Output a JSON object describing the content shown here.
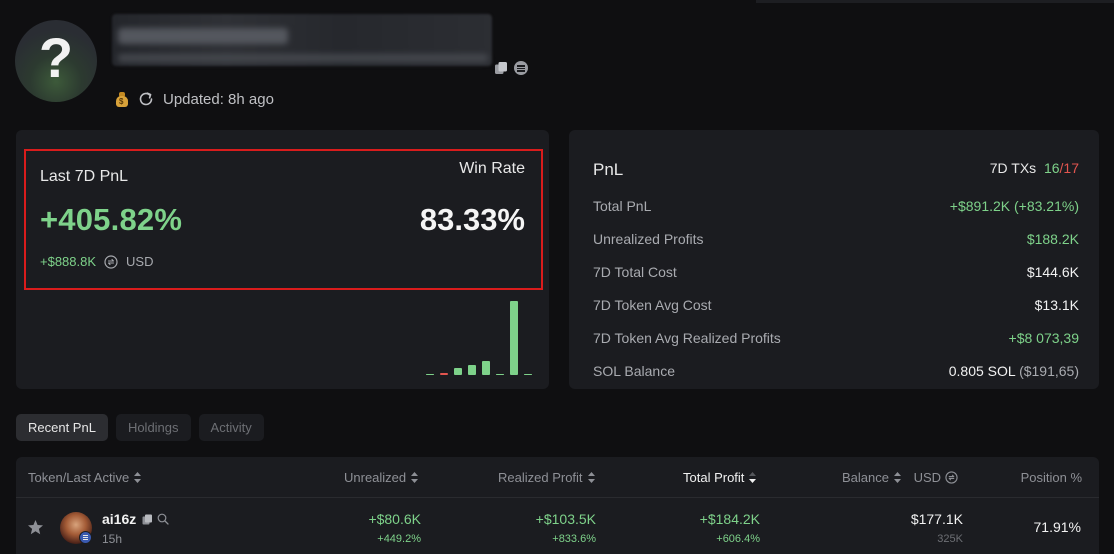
{
  "header": {
    "updated_text": "Updated: 8h ago",
    "icons": [
      "money-bag-icon",
      "refresh-icon",
      "copy-icon",
      "menu-icon"
    ]
  },
  "left_card": {
    "pnl_label": "Last 7D PnL",
    "win_rate_label": "Win Rate",
    "pnl_percent": "+405.82%",
    "win_rate": "83.33%",
    "pnl_usd": "+$888.8K",
    "currency": "USD",
    "bars": [
      {
        "value": 0.02,
        "color": "#7ed28a"
      },
      {
        "value": 0.03,
        "color": "#e2554f"
      },
      {
        "value": 0.09,
        "color": "#7ed28a"
      },
      {
        "value": 0.14,
        "color": "#7ed28a"
      },
      {
        "value": 0.19,
        "color": "#7ed28a"
      },
      {
        "value": 0.02,
        "color": "#7ed28a"
      },
      {
        "value": 1.0,
        "color": "#7ed28a"
      },
      {
        "value": 0.02,
        "color": "#7ed28a"
      }
    ]
  },
  "right_card": {
    "title": "PnL",
    "tx_label": "7D TXs",
    "tx_win": "16",
    "tx_sep": "/",
    "tx_total": "17",
    "rows": [
      {
        "label": "Total PnL",
        "value": "+$891.2K (+83.21%)"
      },
      {
        "label": "Unrealized Profits",
        "value": "$188.2K"
      },
      {
        "label": "7D Total Cost",
        "value": "$144.6K"
      },
      {
        "label": "7D Token Avg Cost",
        "value": "$13.1K"
      },
      {
        "label": "7D Token Avg Realized Profits",
        "value": "+$8 073,39"
      },
      {
        "label": "SOL Balance",
        "value": "0.805 SOL",
        "value_extra": "($191,65)"
      }
    ]
  },
  "tabs": [
    {
      "label": "Recent PnL",
      "active": true
    },
    {
      "label": "Holdings",
      "active": false
    },
    {
      "label": "Activity",
      "active": false
    }
  ],
  "table": {
    "headers": {
      "token": "Token/Last Active",
      "unrealized": "Unrealized",
      "realized": "Realized Profit",
      "total": "Total Profit",
      "balance": "Balance",
      "usd": "USD",
      "position": "Position %"
    },
    "rows": [
      {
        "name": "ai16z",
        "last_active": "15h",
        "unrealized": "+$80.6K",
        "unrealized_pct": "+449.2%",
        "realized": "+$103.5K",
        "realized_pct": "+833.6%",
        "total": "+$184.2K",
        "total_pct": "+606.4%",
        "balance": "$177.1K",
        "balance_qty": "325K",
        "position": "71.91%"
      }
    ]
  }
}
